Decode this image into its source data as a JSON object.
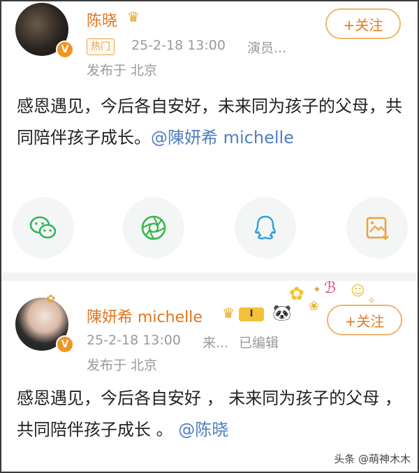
{
  "post1": {
    "author_name": "陈晓",
    "hot_tag": "热门",
    "timestamp": "25-2-18 13:00",
    "source": "演员...",
    "location": "发布于 北京",
    "follow_label": "+关注",
    "content_text": "感恩遇见，今后各自安好，未来同为孩子的父母，共同陪伴孩子成长。",
    "mention": "@陳妍希 michelle",
    "share_icons": [
      "wechat-icon",
      "moments-icon",
      "qq-icon",
      "save-image-icon"
    ]
  },
  "post2": {
    "author_name": "陳妍希 michelle",
    "level_badge": "I",
    "timestamp": "25-2-18 13:00",
    "source": "来...",
    "edited": "已编辑",
    "location": "发布于 北京",
    "follow_label": "+关注",
    "content_text": "感恩遇见，今后各自安好 ， 未来同为孩子的父母 ， 共同陪伴孩子成长 。",
    "mention": "@陈晓"
  },
  "watermark": "头条 @萌神木木",
  "colors": {
    "accent_orange": "#e0761e",
    "mention_blue": "#4f7fbf",
    "meta_gray": "#9a9a9a"
  }
}
